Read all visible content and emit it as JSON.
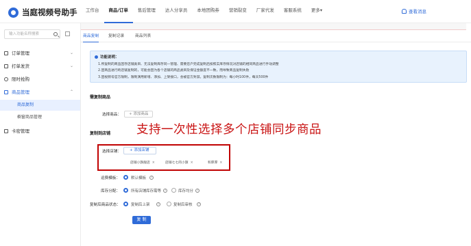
{
  "app": {
    "title": "当庭视频号助手"
  },
  "topnav": [
    "工作台",
    "商品/订单",
    "售后管理",
    "达人分享员",
    "本地团购券",
    "营销裂变",
    "厂家代发",
    "客服系统",
    "更多▾"
  ],
  "header": {
    "message_link": "查看消息"
  },
  "sidebar": {
    "search_placeholder": "输入功能名称搜索",
    "menu": [
      {
        "label": "订单管理",
        "chevron": "⌄"
      },
      {
        "label": "打单发货",
        "chevron": "⌄"
      },
      {
        "label": "限时抢购",
        "chevron": ""
      },
      {
        "label": "商品管理",
        "chevron": "⌃"
      },
      {
        "label": "卡密管理",
        "chevron": ""
      }
    ],
    "submenu": [
      "商品复制",
      "橱窗商品管理"
    ]
  },
  "tabs": [
    "商品复制",
    "复制记录",
    "商品列表"
  ],
  "notice": {
    "title": "功能说明：",
    "lines": [
      "1.所复制的商品因存店铺类目、无法复制库存同一管理、需要您户完成复制后按照实库存情况对店铺的相同商品进行手动调整",
      "2.因商品进行跨店铺复制的，可能会因为各个店铺的商品类目及保证金额度不一致，而导致商品复制失败",
      "3.因视频号官方限制，限制演用新增、添加、上架接口，会被官方封禁。复制次数限制为：每小时100件，每天500件"
    ]
  },
  "form": {
    "section_copy": "需复制商品",
    "select_goods_label": "选择商品：",
    "add_goods_button": "+ 添加商品",
    "section_stores": "复制到店铺",
    "select_store_label": "选择店铺：",
    "add_store_button": "+ 添加店铺",
    "store_tags": [
      "店铺小旗舰店",
      "店铺七七的小旗",
      "和厚厚"
    ],
    "tag_close": "×",
    "shipping_label": "运费模板：",
    "shipping_option": "默认模板",
    "stock_label": "库存分配：",
    "stock_option_1": "所有店铺库存需等",
    "stock_option_2": "库存均分",
    "status_label": "复制后商品状态：",
    "status_option_1": "复制后上架",
    "status_option_2": "复制后审核",
    "submit": "复 制",
    "help_mark": "?"
  },
  "annotation": {
    "text": "支持一次性选择多个店铺同步商品"
  },
  "colors": {
    "accent": "#2f6bd8",
    "annotation": "#c91414",
    "highlight_box": "#c00000"
  }
}
